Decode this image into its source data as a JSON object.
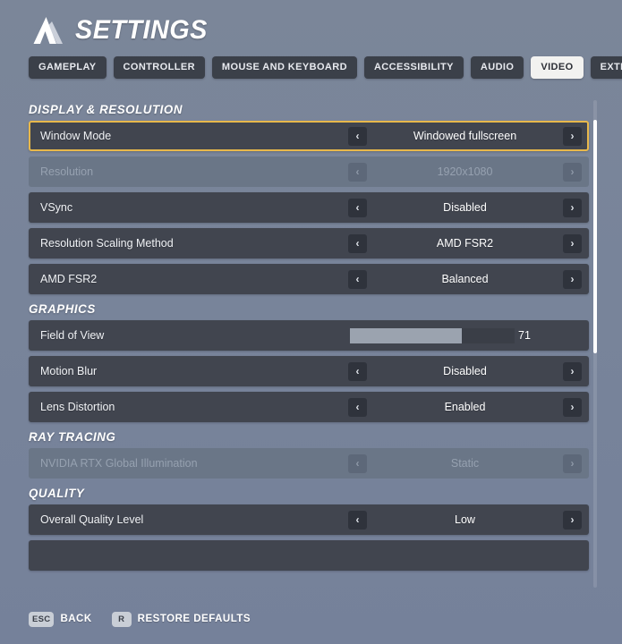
{
  "header": {
    "logo_icon": "chevron-mountain-logo-icon",
    "title": "SETTINGS"
  },
  "tabs": [
    {
      "label": "GAMEPLAY",
      "active": false
    },
    {
      "label": "CONTROLLER",
      "active": false
    },
    {
      "label": "MOUSE AND KEYBOARD",
      "active": false
    },
    {
      "label": "ACCESSIBILITY",
      "active": false
    },
    {
      "label": "AUDIO",
      "active": false
    },
    {
      "label": "VIDEO",
      "active": true
    },
    {
      "label": "EXTRAS",
      "active": false
    }
  ],
  "colors": {
    "page_background": "#78849a",
    "row_background": "#41454f",
    "row_disabled_background": "#6a7687",
    "selection_highlight": "#e8b84b",
    "tab_active_background": "#f2f2f0",
    "tab_inactive_background": "#3b4049",
    "slider_fill": "#9ba3af",
    "scrollbar_thumb": "#ffffff"
  },
  "sections": [
    {
      "title": "DISPLAY & RESOLUTION",
      "rows": [
        {
          "label": "Window Mode",
          "type": "stepper",
          "value": "Windowed fullscreen",
          "selected": true,
          "disabled": false
        },
        {
          "label": "Resolution",
          "type": "stepper",
          "value": "1920x1080",
          "selected": false,
          "disabled": true
        },
        {
          "label": "VSync",
          "type": "stepper",
          "value": "Disabled",
          "selected": false,
          "disabled": false
        },
        {
          "label": "Resolution Scaling Method",
          "type": "stepper",
          "value": "AMD FSR2",
          "selected": false,
          "disabled": false
        },
        {
          "label": "AMD FSR2",
          "type": "stepper",
          "value": "Balanced",
          "selected": false,
          "disabled": false
        }
      ]
    },
    {
      "title": "GRAPHICS",
      "rows": [
        {
          "label": "Field of View",
          "type": "slider",
          "value": "71",
          "percent": 68,
          "selected": false,
          "disabled": false
        },
        {
          "label": "Motion Blur",
          "type": "stepper",
          "value": "Disabled",
          "selected": false,
          "disabled": false
        },
        {
          "label": "Lens Distortion",
          "type": "stepper",
          "value": "Enabled",
          "selected": false,
          "disabled": false
        }
      ]
    },
    {
      "title": "RAY TRACING",
      "rows": [
        {
          "label": "NVIDIA RTX Global Illumination",
          "type": "stepper",
          "value": "Static",
          "selected": false,
          "disabled": true
        }
      ]
    },
    {
      "title": "QUALITY",
      "rows": [
        {
          "label": "Overall Quality Level",
          "type": "stepper",
          "value": "Low",
          "selected": false,
          "disabled": false
        },
        {
          "label": "",
          "type": "stepper",
          "value": "",
          "selected": false,
          "disabled": false,
          "clipped": true
        }
      ]
    }
  ],
  "controls": {
    "prev_arrow": "‹",
    "next_arrow": "›"
  },
  "scrollbar": {
    "thumb_top_percent": 4,
    "thumb_height_percent": 48
  },
  "footer": {
    "hints": [
      {
        "key": "ESC",
        "label": "BACK"
      },
      {
        "key": "R",
        "label": "RESTORE DEFAULTS"
      }
    ]
  }
}
